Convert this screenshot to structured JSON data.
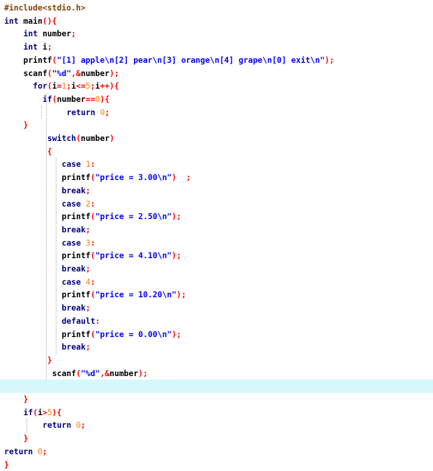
{
  "editor": {
    "current_line_index": 29,
    "colors": {
      "background": "#ffffff",
      "current_line": "#d6f8fb",
      "keyword": "#000080",
      "preprocessor": "#804000",
      "operator": "#ff0000",
      "number": "#ff8000",
      "string": "#0000ff",
      "plain": "#000000"
    },
    "lines": [
      {
        "indent": 0,
        "tokens": [
          {
            "t": "#include",
            "k": "pp"
          },
          {
            "t": "<stdio.h>",
            "k": "pp"
          }
        ]
      },
      {
        "indent": 0,
        "tokens": [
          {
            "t": "int",
            "k": "kw"
          },
          {
            "t": " main",
            "k": "text"
          },
          {
            "t": "(){",
            "k": "op"
          }
        ]
      },
      {
        "indent": 4,
        "tokens": [
          {
            "t": "int",
            "k": "kw"
          },
          {
            "t": " number",
            "k": "text"
          },
          {
            "t": ";",
            "k": "op"
          }
        ]
      },
      {
        "indent": 4,
        "tokens": [
          {
            "t": "int",
            "k": "kw"
          },
          {
            "t": " i",
            "k": "text"
          },
          {
            "t": ";",
            "k": "op"
          }
        ]
      },
      {
        "indent": 4,
        "tokens": [
          {
            "t": "printf",
            "k": "text"
          },
          {
            "t": "(",
            "k": "op"
          },
          {
            "t": "\"[1] apple\\n[2] pear\\n[3] orange\\n[4] grape\\n[0] exit\\n\"",
            "k": "str"
          },
          {
            "t": ");",
            "k": "op"
          }
        ]
      },
      {
        "indent": 4,
        "tokens": [
          {
            "t": "scanf",
            "k": "text"
          },
          {
            "t": "(",
            "k": "op"
          },
          {
            "t": "\"%d\"",
            "k": "str"
          },
          {
            "t": ",&",
            "k": "op"
          },
          {
            "t": "number",
            "k": "text"
          },
          {
            "t": ");",
            "k": "op"
          }
        ]
      },
      {
        "indent": 6,
        "tokens": [
          {
            "t": "for",
            "k": "kw"
          },
          {
            "t": "(",
            "k": "op"
          },
          {
            "t": "i",
            "k": "text"
          },
          {
            "t": "=",
            "k": "op"
          },
          {
            "t": "1",
            "k": "num"
          },
          {
            "t": ";",
            "k": "op"
          },
          {
            "t": "i",
            "k": "text"
          },
          {
            "t": "<=",
            "k": "op"
          },
          {
            "t": "5",
            "k": "num"
          },
          {
            "t": ";",
            "k": "op"
          },
          {
            "t": "i",
            "k": "text"
          },
          {
            "t": "++){",
            "k": "op"
          }
        ]
      },
      {
        "indent": 8,
        "tokens": [
          {
            "t": "if",
            "k": "kw"
          },
          {
            "t": "(",
            "k": "op"
          },
          {
            "t": "number",
            "k": "text"
          },
          {
            "t": "==",
            "k": "op"
          },
          {
            "t": "0",
            "k": "num"
          },
          {
            "t": "){",
            "k": "op"
          }
        ]
      },
      {
        "indent": 13,
        "tokens": [
          {
            "t": "return",
            "k": "kw"
          },
          {
            "t": " ",
            "k": "text"
          },
          {
            "t": "0",
            "k": "num"
          },
          {
            "t": ";",
            "k": "op"
          }
        ]
      },
      {
        "indent": 4,
        "tokens": [
          {
            "t": "}",
            "k": "op"
          }
        ]
      },
      {
        "indent": 9,
        "tokens": [
          {
            "t": "switch",
            "k": "kw"
          },
          {
            "t": "(",
            "k": "op"
          },
          {
            "t": "number",
            "k": "text"
          },
          {
            "t": ")",
            "k": "op"
          }
        ]
      },
      {
        "indent": 9,
        "tokens": [
          {
            "t": "{",
            "k": "op"
          }
        ]
      },
      {
        "indent": 12,
        "tokens": [
          {
            "t": "case",
            "k": "kw"
          },
          {
            "t": " ",
            "k": "text"
          },
          {
            "t": "1",
            "k": "num"
          },
          {
            "t": ":",
            "k": "op"
          }
        ]
      },
      {
        "indent": 12,
        "tokens": [
          {
            "t": "printf",
            "k": "text"
          },
          {
            "t": "(",
            "k": "op"
          },
          {
            "t": "\"price = 3.00\\n\"",
            "k": "str"
          },
          {
            "t": ")  ;",
            "k": "op"
          }
        ]
      },
      {
        "indent": 12,
        "tokens": [
          {
            "t": "break",
            "k": "kw"
          },
          {
            "t": ";",
            "k": "op"
          }
        ]
      },
      {
        "indent": 12,
        "tokens": [
          {
            "t": "case",
            "k": "kw"
          },
          {
            "t": " ",
            "k": "text"
          },
          {
            "t": "2",
            "k": "num"
          },
          {
            "t": ":",
            "k": "op"
          }
        ]
      },
      {
        "indent": 12,
        "tokens": [
          {
            "t": "printf",
            "k": "text"
          },
          {
            "t": "(",
            "k": "op"
          },
          {
            "t": "\"price = 2.50\\n\"",
            "k": "str"
          },
          {
            "t": ");",
            "k": "op"
          }
        ]
      },
      {
        "indent": 12,
        "tokens": [
          {
            "t": "break",
            "k": "kw"
          },
          {
            "t": ";",
            "k": "op"
          }
        ]
      },
      {
        "indent": 12,
        "tokens": [
          {
            "t": "case",
            "k": "kw"
          },
          {
            "t": " ",
            "k": "text"
          },
          {
            "t": "3",
            "k": "num"
          },
          {
            "t": ":",
            "k": "op"
          }
        ]
      },
      {
        "indent": 12,
        "tokens": [
          {
            "t": "printf",
            "k": "text"
          },
          {
            "t": "(",
            "k": "op"
          },
          {
            "t": "\"price = 4.10\\n\"",
            "k": "str"
          },
          {
            "t": ");",
            "k": "op"
          }
        ]
      },
      {
        "indent": 12,
        "tokens": [
          {
            "t": "break",
            "k": "kw"
          },
          {
            "t": ";",
            "k": "op"
          }
        ]
      },
      {
        "indent": 12,
        "tokens": [
          {
            "t": "case",
            "k": "kw"
          },
          {
            "t": " ",
            "k": "text"
          },
          {
            "t": "4",
            "k": "num"
          },
          {
            "t": ":",
            "k": "op"
          }
        ]
      },
      {
        "indent": 12,
        "tokens": [
          {
            "t": "printf",
            "k": "text"
          },
          {
            "t": "(",
            "k": "op"
          },
          {
            "t": "\"price = 10.20\\n\"",
            "k": "str"
          },
          {
            "t": ");",
            "k": "op"
          }
        ]
      },
      {
        "indent": 12,
        "tokens": [
          {
            "t": "break",
            "k": "kw"
          },
          {
            "t": ";",
            "k": "op"
          }
        ]
      },
      {
        "indent": 12,
        "tokens": [
          {
            "t": "default",
            "k": "kw"
          },
          {
            "t": ":",
            "k": "op"
          }
        ]
      },
      {
        "indent": 12,
        "tokens": [
          {
            "t": "printf",
            "k": "text"
          },
          {
            "t": "(",
            "k": "op"
          },
          {
            "t": "\"price = 0.00\\n\"",
            "k": "str"
          },
          {
            "t": ");",
            "k": "op"
          }
        ]
      },
      {
        "indent": 12,
        "tokens": [
          {
            "t": "break",
            "k": "kw"
          },
          {
            "t": ";",
            "k": "op"
          }
        ]
      },
      {
        "indent": 9,
        "tokens": [
          {
            "t": "}",
            "k": "op"
          }
        ]
      },
      {
        "indent": 10,
        "tokens": [
          {
            "t": "scanf",
            "k": "text"
          },
          {
            "t": "(",
            "k": "op"
          },
          {
            "t": "\"%d\"",
            "k": "str"
          },
          {
            "t": ",&",
            "k": "op"
          },
          {
            "t": "number",
            "k": "text"
          },
          {
            "t": ");",
            "k": "op"
          }
        ]
      },
      {
        "indent": 0,
        "tokens": []
      },
      {
        "indent": 4,
        "tokens": [
          {
            "t": "}",
            "k": "op"
          }
        ]
      },
      {
        "indent": 4,
        "tokens": [
          {
            "t": "if",
            "k": "kw"
          },
          {
            "t": "(",
            "k": "op"
          },
          {
            "t": "i",
            "k": "text"
          },
          {
            "t": ">",
            "k": "op"
          },
          {
            "t": "5",
            "k": "num"
          },
          {
            "t": "){",
            "k": "op"
          }
        ]
      },
      {
        "indent": 8,
        "tokens": [
          {
            "t": "return",
            "k": "kw"
          },
          {
            "t": " ",
            "k": "text"
          },
          {
            "t": "0",
            "k": "num"
          },
          {
            "t": ";",
            "k": "op"
          }
        ]
      },
      {
        "indent": 4,
        "tokens": [
          {
            "t": "}",
            "k": "op"
          }
        ]
      },
      {
        "indent": 0,
        "tokens": [
          {
            "t": "return",
            "k": "kw"
          },
          {
            "t": " ",
            "k": "text"
          },
          {
            "t": "0",
            "k": "num"
          },
          {
            "t": ";",
            "k": "op"
          }
        ]
      },
      {
        "indent": 0,
        "tokens": [
          {
            "t": "}",
            "k": "op"
          }
        ]
      }
    ]
  }
}
